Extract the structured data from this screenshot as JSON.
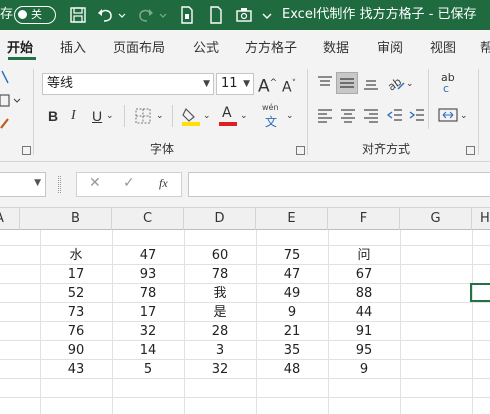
{
  "titlebar": {
    "autosave_label": "存",
    "autosave_state": "关",
    "doc_title": "Excel代制作 找方方格子 - 已保存"
  },
  "ribbon_tabs": [
    "开始",
    "插入",
    "页面布局",
    "公式",
    "方方格子",
    "数据",
    "审阅",
    "视图",
    "帮"
  ],
  "font_group": {
    "font_name": "等线",
    "font_size": "11",
    "label": "字体",
    "grow_glyph": "A",
    "shrink_glyph": "A",
    "bold": "B",
    "italic": "I",
    "underline": "U",
    "font_color_glyph": "A",
    "phonetic_top": "wén",
    "phonetic_bottom": "文"
  },
  "alignment_group": {
    "label": "对齐方式",
    "wrap_glyph": "ab",
    "wrap_glyph2": "c"
  },
  "formula_bar": {
    "fx_label": "fx",
    "cancel_glyph": "✕",
    "enter_glyph": "✓"
  },
  "columns": [
    "A",
    "B",
    "C",
    "D",
    "E",
    "F",
    "G",
    "H"
  ],
  "rows": [
    [
      "",
      "水",
      "47",
      "60",
      "75",
      "问"
    ],
    [
      "",
      "17",
      "93",
      "78",
      "47",
      "67"
    ],
    [
      "",
      "52",
      "78",
      "我",
      "49",
      "88"
    ],
    [
      "",
      "73",
      "17",
      "是",
      "9",
      "44"
    ],
    [
      "",
      "76",
      "32",
      "28",
      "21",
      "91"
    ],
    [
      "",
      "90",
      "14",
      "3",
      "35",
      "95"
    ],
    [
      "",
      "43",
      "5",
      "32",
      "48",
      "9"
    ]
  ],
  "colors": {
    "titlebar_bg": "#1f6b3f",
    "accent": "#217346",
    "highlight_yellow": "#ffe000",
    "font_red": "#e02020"
  }
}
